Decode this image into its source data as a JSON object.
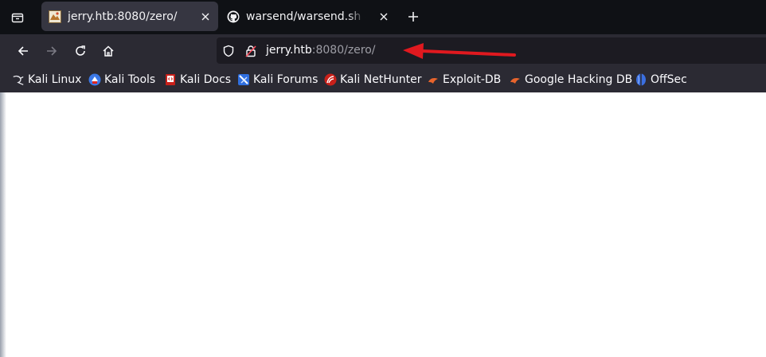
{
  "tabs": [
    {
      "title": "jerry.htb:8080/zero/",
      "active": true,
      "favicon": "page-favicon-icon"
    },
    {
      "title": "warsend/warsend.sh at m",
      "active": false,
      "favicon": "github-icon"
    }
  ],
  "navigation": {
    "url_host": "jerry.htb",
    "url_rest": ":8080/zero/"
  },
  "bookmarks": [
    {
      "label": "Kali Linux",
      "icon": "kali-dragon-icon"
    },
    {
      "label": "Kali Tools",
      "icon": "kali-tools-icon"
    },
    {
      "label": "Kali Docs",
      "icon": "kali-docs-icon"
    },
    {
      "label": "Kali Forums",
      "icon": "kali-forums-icon"
    },
    {
      "label": "Kali NetHunter",
      "icon": "kali-nethunter-icon"
    },
    {
      "label": "Exploit-DB",
      "icon": "exploit-db-icon"
    },
    {
      "label": "Google Hacking DB",
      "icon": "ghdb-icon"
    },
    {
      "label": "OffSec",
      "icon": "offsec-icon"
    }
  ],
  "colors": {
    "tabstrip": "#0f1115",
    "toolbar": "#2b2a33",
    "urlbar": "#1c1b22",
    "annotation_arrow": "#e0191f"
  }
}
